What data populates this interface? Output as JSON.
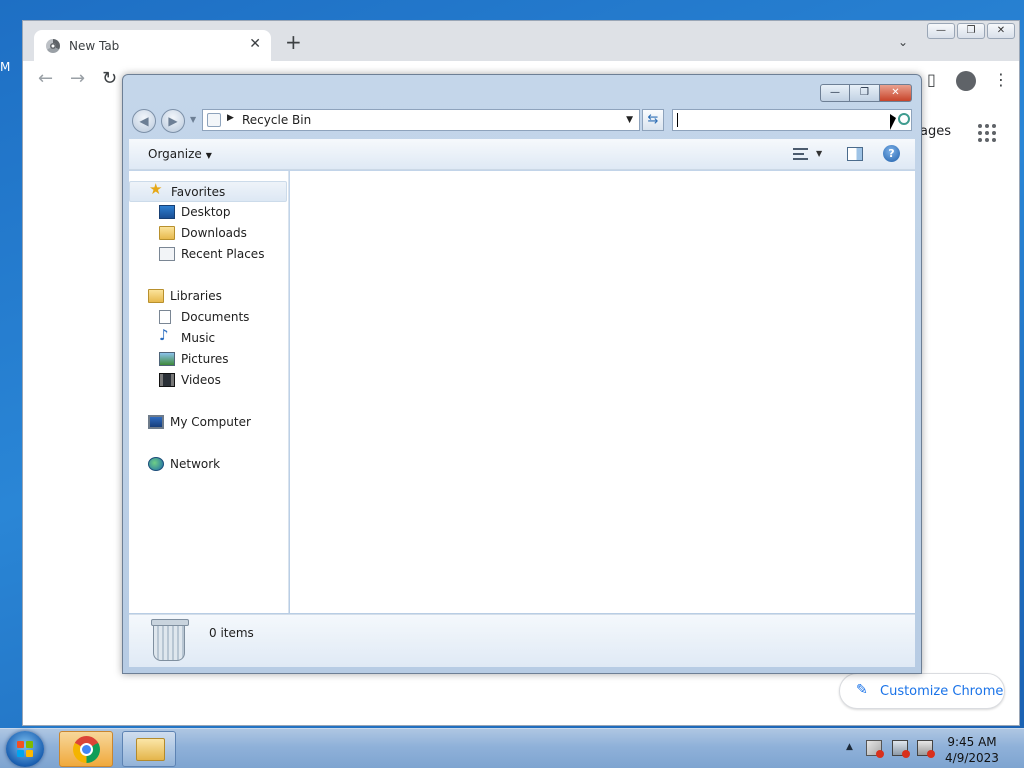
{
  "desktop": {
    "edge_glyph": "M"
  },
  "chrome": {
    "tab_title": "New Tab",
    "tab_close": "✕",
    "new_tab": "+",
    "tab_menu": "⌄",
    "apps_partial_text": "ages",
    "customize_label": "Customize Chrome",
    "customize_icon": "✎",
    "nav": {
      "back": "←",
      "forward": "→",
      "reload": "↻"
    },
    "window_controls": {
      "min": "—",
      "max": "❐",
      "close": "✕"
    },
    "toolbar": {
      "side_panel": "▯",
      "menu": "⋮"
    }
  },
  "explorer": {
    "caption": {
      "min": "—",
      "max": "❐",
      "close": "✕"
    },
    "address": {
      "location": "Recycle Bin",
      "separator": "▶",
      "dropdown": "▼"
    },
    "refresh_glyph": "⇆",
    "search": {
      "value": "",
      "placeholder": ""
    },
    "organize_label": "Organize",
    "help_glyph": "?",
    "nav_items": [
      {
        "label": "Favorites",
        "icon": "star-icon"
      },
      {
        "label": "Desktop",
        "icon": "desktop-icon"
      },
      {
        "label": "Downloads",
        "icon": "downloads-folder-icon"
      },
      {
        "label": "Recent Places",
        "icon": "recent-places-icon"
      },
      {
        "label": "Libraries",
        "icon": "libraries-folder-icon"
      },
      {
        "label": "Documents",
        "icon": "documents-icon"
      },
      {
        "label": "Music",
        "icon": "music-icon"
      },
      {
        "label": "Pictures",
        "icon": "pictures-icon"
      },
      {
        "label": "Videos",
        "icon": "videos-icon"
      },
      {
        "label": "My Computer",
        "icon": "computer-icon"
      },
      {
        "label": "Network",
        "icon": "network-icon"
      }
    ],
    "status": {
      "item_count": "0 items"
    }
  },
  "taskbar": {
    "clock": {
      "time": "9:45 AM",
      "date": "4/9/2023"
    },
    "tray_arrow": "▲"
  },
  "colors": {
    "desktop_blue": "#1e6fc4",
    "chrome_accent": "#1a73e8",
    "explorer_frame": "#c4d6ea",
    "close_red": "#c8442a"
  }
}
